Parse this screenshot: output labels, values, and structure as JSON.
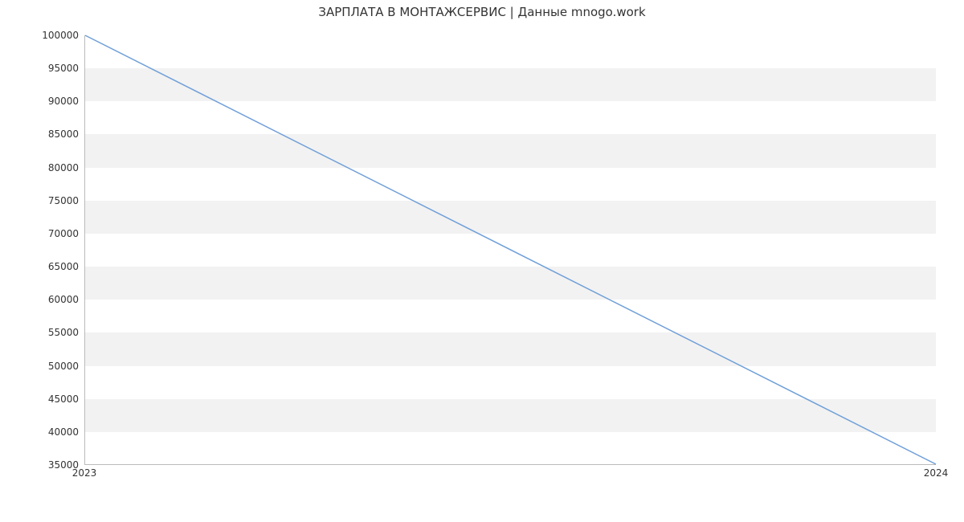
{
  "chart_data": {
    "type": "line",
    "title": "ЗАРПЛАТА В МОНТАЖСЕРВИС | Данные mnogo.work",
    "xlabel": "",
    "ylabel": "",
    "x": [
      2023,
      2024
    ],
    "values": [
      100000,
      35000
    ],
    "ylim": [
      35000,
      100000
    ],
    "yticks": [
      35000,
      40000,
      45000,
      50000,
      55000,
      60000,
      65000,
      70000,
      75000,
      80000,
      85000,
      90000,
      95000,
      100000
    ],
    "xticks": [
      2023,
      2024
    ],
    "line_color": "#6f9fd8"
  }
}
